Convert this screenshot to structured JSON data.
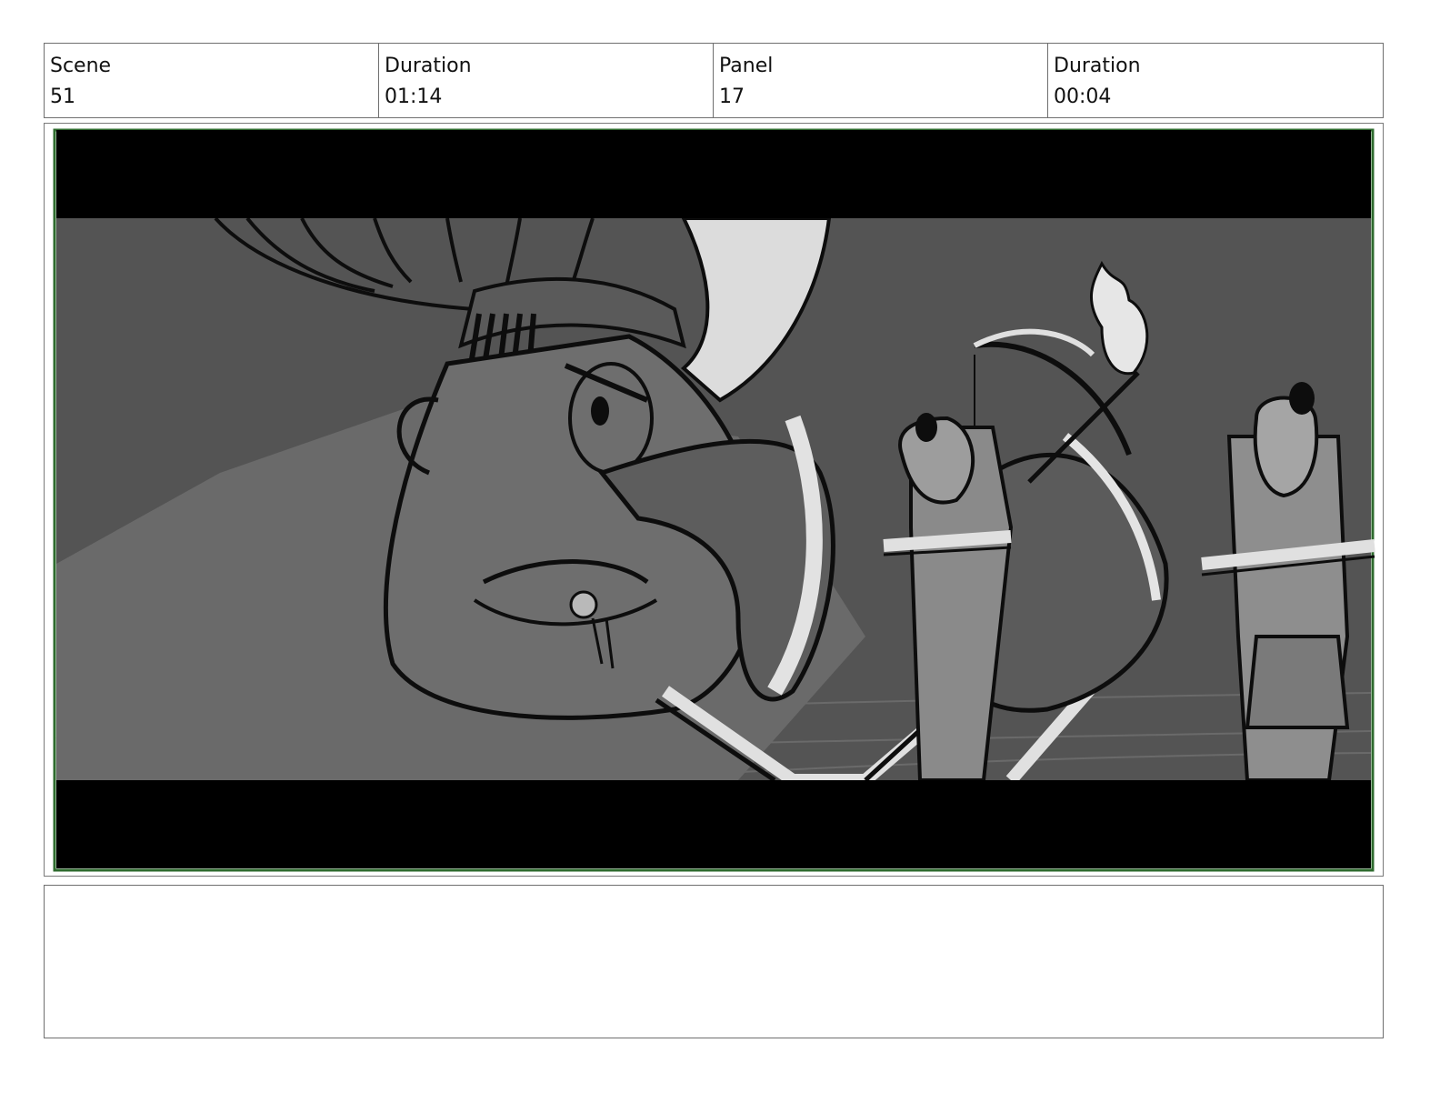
{
  "header": {
    "scene_label": "Scene",
    "scene_value": "51",
    "scene_duration_label": "Duration",
    "scene_duration_value": "01:14",
    "panel_label": "Panel",
    "panel_value": "17",
    "panel_duration_label": "Duration",
    "panel_duration_value": "00:04"
  },
  "notes": {
    "text": ""
  }
}
